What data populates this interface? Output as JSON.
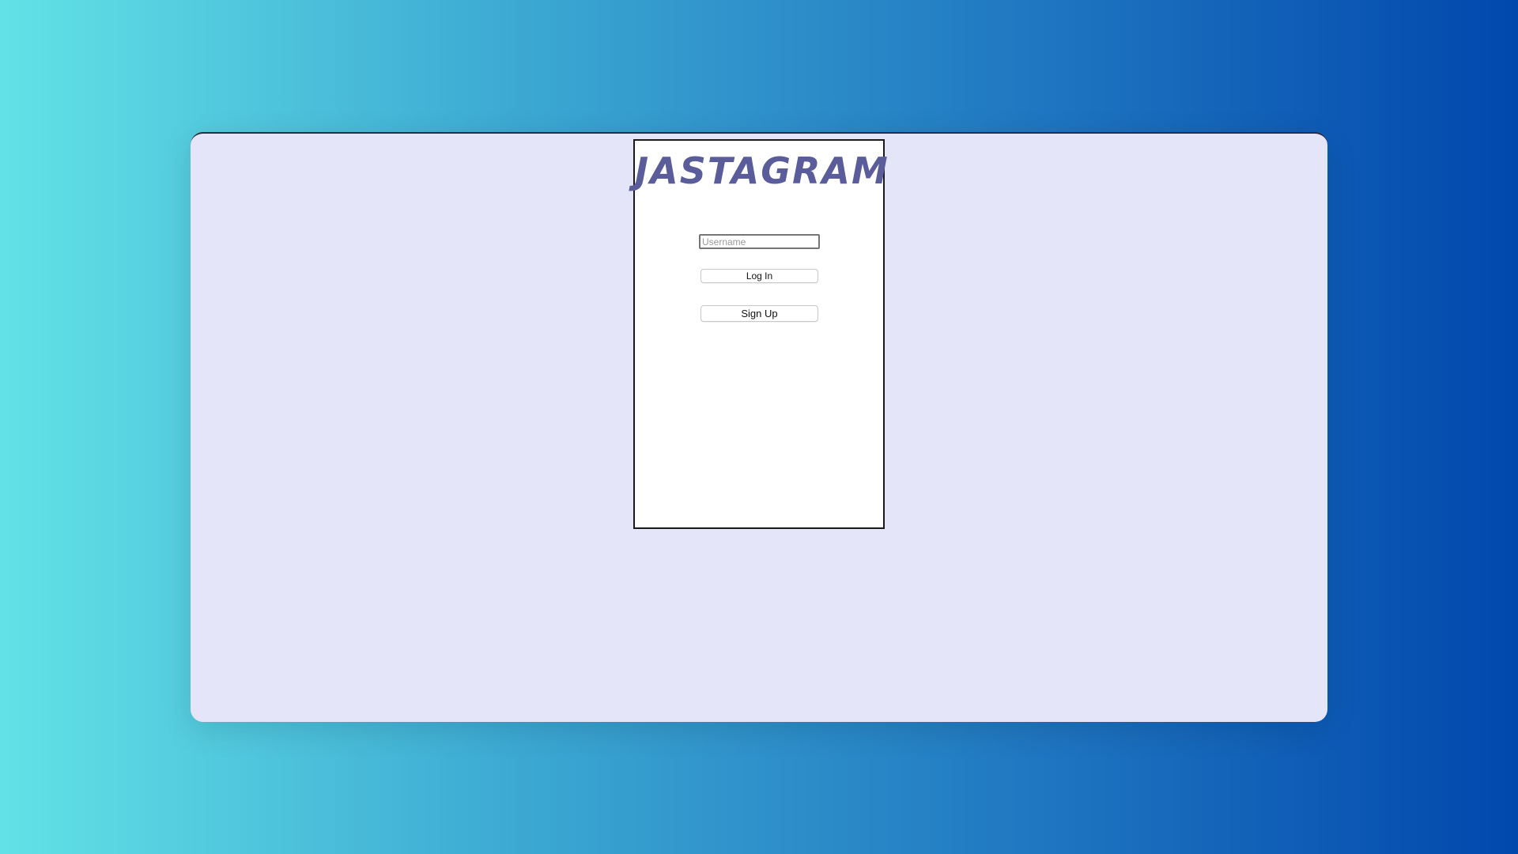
{
  "app": {
    "logo_text": "JASTAGRAM"
  },
  "login_form": {
    "username_placeholder": "Username",
    "username_value": "",
    "login_label": "Log In",
    "signup_label": "Sign Up"
  },
  "colors": {
    "logo": "#5b5d9b",
    "window_background": "#e4e5f9",
    "gradient_start": "#62e2e6",
    "gradient_end": "#0148ad"
  }
}
